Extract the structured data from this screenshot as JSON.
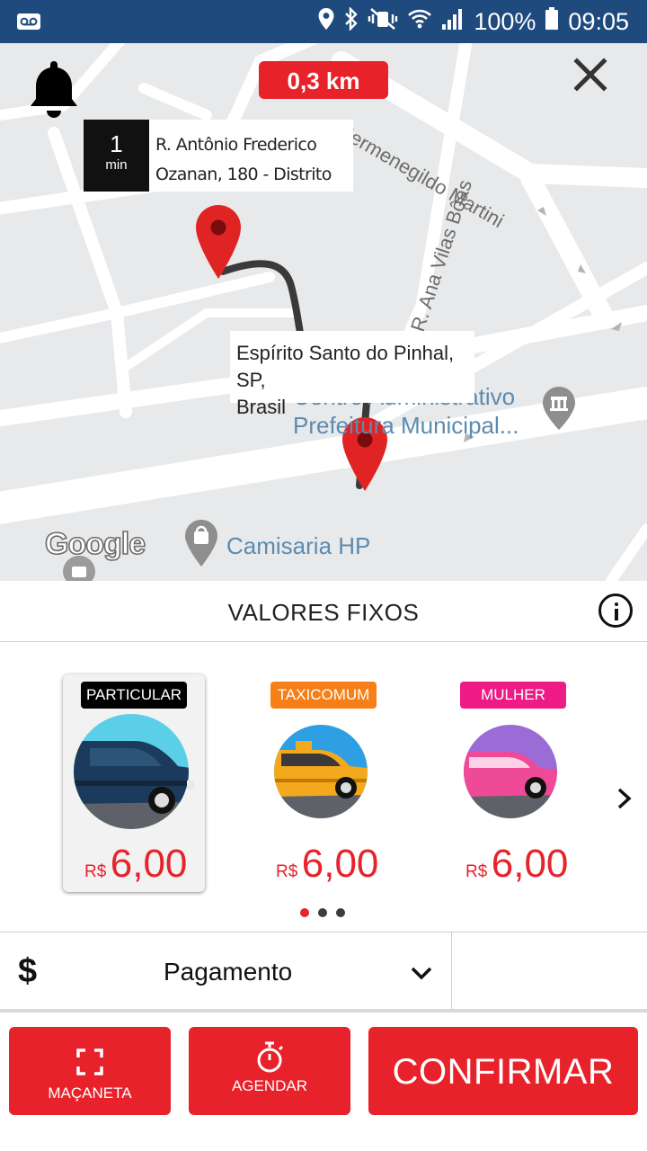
{
  "status_bar": {
    "battery": "100%",
    "time": "09:05",
    "left_icon": "voicemail-icon",
    "right_icons": [
      "location-icon",
      "bluetooth-icon",
      "mute-vibrate-icon",
      "wifi-icon",
      "signal-icon",
      "battery-icon"
    ]
  },
  "map": {
    "distance": "0,3 km",
    "origin": {
      "minutes": "1",
      "minutes_label": "min",
      "line1": "R. Antônio Frederico",
      "line2": "Ozanan, 180 - Distrito"
    },
    "destination": {
      "line1": "Espírito Santo do Pinhal, SP,",
      "line2": "Brasil"
    },
    "streets": {
      "hermenegildo": "Hermenegildo Martini",
      "ana_vilas_boas": "R. Ana Vilas Bôas"
    },
    "pois": {
      "prefeitura_line1": "Centro Administrativo",
      "prefeitura_line2": "Prefeitura Municipal...",
      "camisaria": "Camisaria HP"
    },
    "attribution": "Google",
    "colors": {
      "route": "#3a3a3a",
      "pin": "#e02424"
    }
  },
  "fares": {
    "title": "VALORES FIXOS",
    "items": [
      {
        "tag": "PARTICULAR",
        "tag_color": "#000000",
        "currency": "R$",
        "price": "6,00",
        "selected": true
      },
      {
        "tag": "TAXICOMUM",
        "tag_color": "#f77f17",
        "currency": "R$",
        "price": "6,00",
        "selected": false
      },
      {
        "tag": "MULHER",
        "tag_color": "#ee1b86",
        "currency": "R$",
        "price": "6,00",
        "selected": false
      }
    ],
    "page_count": 3,
    "current_page": 1
  },
  "payment": {
    "icon": "dollar-icon",
    "label": "Pagamento"
  },
  "buttons": {
    "macaneta": "MAÇANETA",
    "agendar": "AGENDAR",
    "confirmar": "CONFIRMAR"
  },
  "colors": {
    "accent": "#e8222b",
    "status_bar": "#1f4a7e"
  }
}
